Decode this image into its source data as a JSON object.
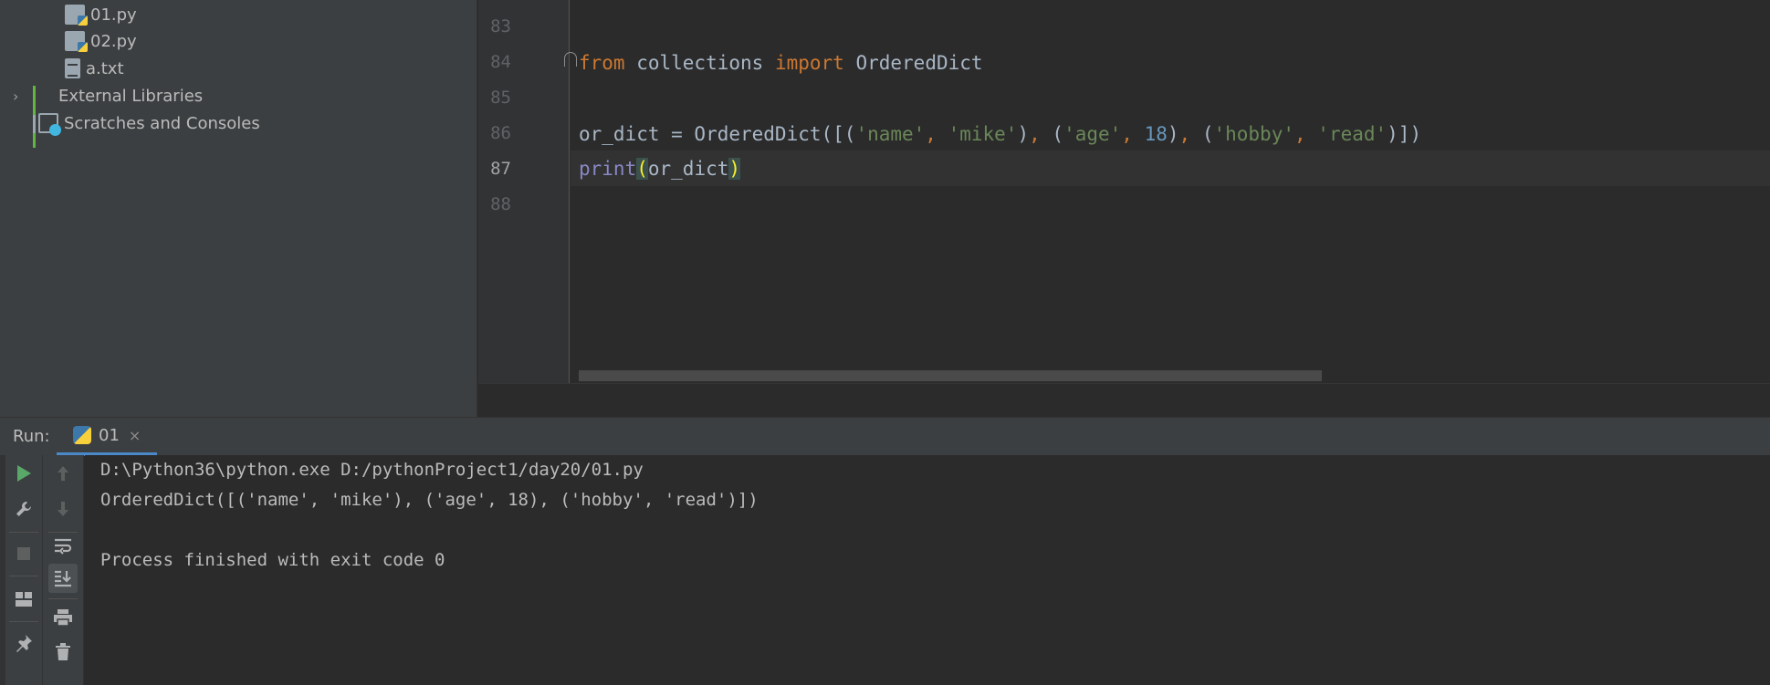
{
  "project_tree": {
    "items": [
      {
        "label": "01.py",
        "icon": "python-file-icon"
      },
      {
        "label": "02.py",
        "icon": "python-file-icon"
      },
      {
        "label": "a.txt",
        "icon": "text-file-icon"
      },
      {
        "label": "External Libraries",
        "icon": "libraries-icon",
        "expand_arrow": "›"
      },
      {
        "label": "Scratches and Consoles",
        "icon": "scratches-icon"
      }
    ]
  },
  "editor": {
    "line_numbers": [
      "83",
      "84",
      "85",
      "86",
      "87",
      "88"
    ],
    "current_line": "87",
    "lines": {
      "l84": {
        "kw1": "from",
        "mod": " collections ",
        "kw2": "import",
        "name": " OrderedDict"
      },
      "l86": {
        "p1": "or_dict = OrderedDict([(",
        "s1": "'name'",
        "c1": ", ",
        "s2": "'mike'",
        "p2": ")",
        "c2": ", ",
        "p3": "(",
        "s3": "'age'",
        "c3": ", ",
        "n1": "18",
        "p4": ")",
        "c4": ", ",
        "p5": "(",
        "s4": "'hobby'",
        "c5": ", ",
        "s5": "'read'",
        "p6": ")])"
      },
      "l87": {
        "fn": "print",
        "open": "(",
        "arg": "or_dict",
        "close": ")"
      }
    }
  },
  "run": {
    "label": "Run:",
    "tab_label": "01",
    "tab_close": "×",
    "console_lines": [
      "D:\\Python36\\python.exe D:/pythonProject1/day20/01.py",
      "OrderedDict([('name', 'mike'), ('age', 18), ('hobby', 'read')])",
      "",
      "Process finished with exit code 0"
    ]
  },
  "toolbar_icons": {
    "rerun": "play-icon",
    "settings": "wrench-icon",
    "stop": "stop-icon",
    "layout": "layout-icon",
    "pin": "pin-icon",
    "up": "arrow-up-icon",
    "down": "arrow-down-icon",
    "soft_wrap": "soft-wrap-icon",
    "scroll_end": "scroll-to-end-icon",
    "print": "print-icon",
    "trash": "trash-icon"
  },
  "colors": {
    "keyword": "#cc7832",
    "string": "#6a8759",
    "number": "#6897bb",
    "builtin": "#8888c6",
    "accent": "#4a88c7"
  }
}
